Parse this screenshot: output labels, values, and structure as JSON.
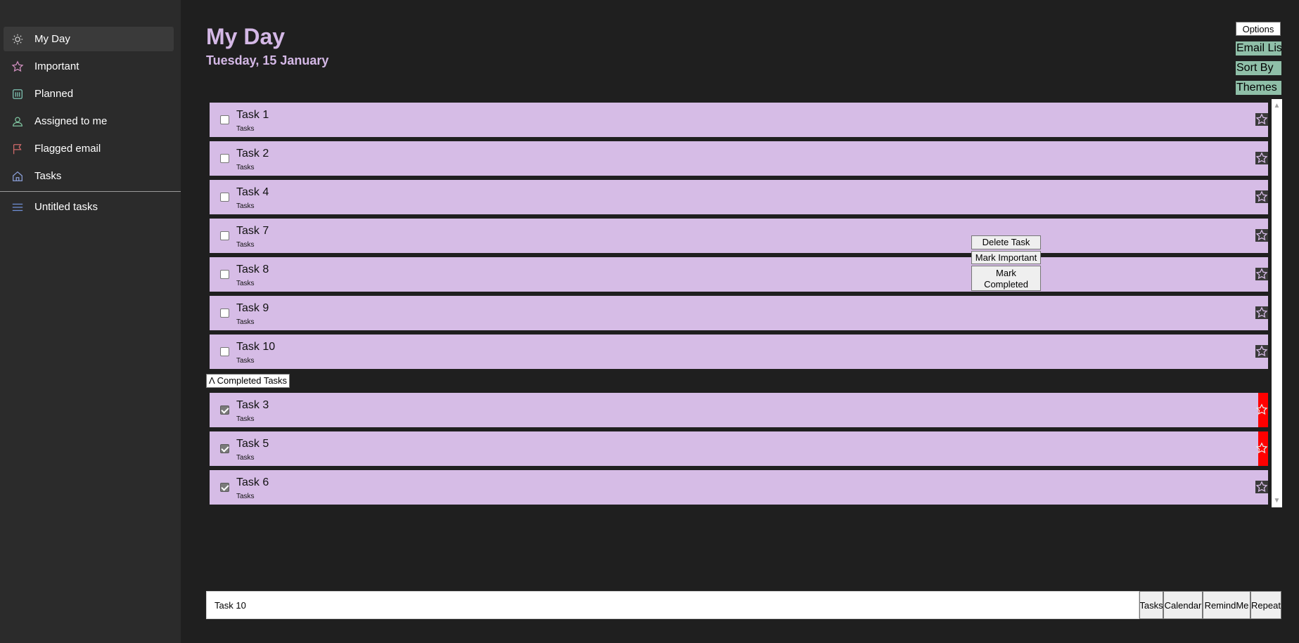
{
  "sidebar": {
    "items": [
      {
        "label": "My Day",
        "icon": "sun-icon",
        "color": "#cfcfcf"
      },
      {
        "label": "Important",
        "icon": "star-icon",
        "color": "#d08fbf"
      },
      {
        "label": "Planned",
        "icon": "calendar-icon",
        "color": "#7fc4b4"
      },
      {
        "label": "Assigned to me",
        "icon": "person-icon",
        "color": "#7fc4a0"
      },
      {
        "label": "Flagged email",
        "icon": "flag-icon",
        "color": "#d06a6a"
      },
      {
        "label": "Tasks",
        "icon": "home-icon",
        "color": "#8a9fd8"
      }
    ],
    "lists": [
      {
        "label": "Untitled tasks",
        "icon": "list-icon",
        "color": "#6f8fd8"
      }
    ]
  },
  "header": {
    "title": "My Day",
    "date": "Tuesday, 15 January"
  },
  "controls": {
    "options_label": "Options",
    "email_list_label": "Email List",
    "sort_by_label": "Sort By",
    "themes_label": "Themes"
  },
  "tasks": [
    {
      "title": "Task 1",
      "list": "Tasks",
      "completed": false
    },
    {
      "title": "Task 2",
      "list": "Tasks",
      "completed": false
    },
    {
      "title": "Task 4",
      "list": "Tasks",
      "completed": false
    },
    {
      "title": "Task 7",
      "list": "Tasks",
      "completed": false
    },
    {
      "title": "Task 8",
      "list": "Tasks",
      "completed": false
    },
    {
      "title": "Task 9",
      "list": "Tasks",
      "completed": false
    },
    {
      "title": "Task 10",
      "list": "Tasks",
      "completed": false
    }
  ],
  "completed_toggle_label": "Λ Completed Tasks",
  "completed_tasks": [
    {
      "title": "Task 3",
      "list": "Tasks",
      "completed": true,
      "flagged": true
    },
    {
      "title": "Task 5",
      "list": "Tasks",
      "completed": true,
      "flagged": true
    },
    {
      "title": "Task 6",
      "list": "Tasks",
      "completed": true,
      "flagged": false
    }
  ],
  "context_menu": {
    "delete_label": "Delete Task",
    "important_label": "Mark Important",
    "completed_label": "Mark Completed"
  },
  "bottom_bar": {
    "input_value": "Task 10",
    "tasks_label": "Tasks",
    "calendar_label": "Calendar",
    "remindme_label": "RemindMe",
    "repeat_label": "Repeat"
  },
  "colors": {
    "accent": "#d4b8e6",
    "task_bg": "#d6bce6",
    "flag": "#ff0000",
    "link_bg": "#8fbfa8"
  }
}
